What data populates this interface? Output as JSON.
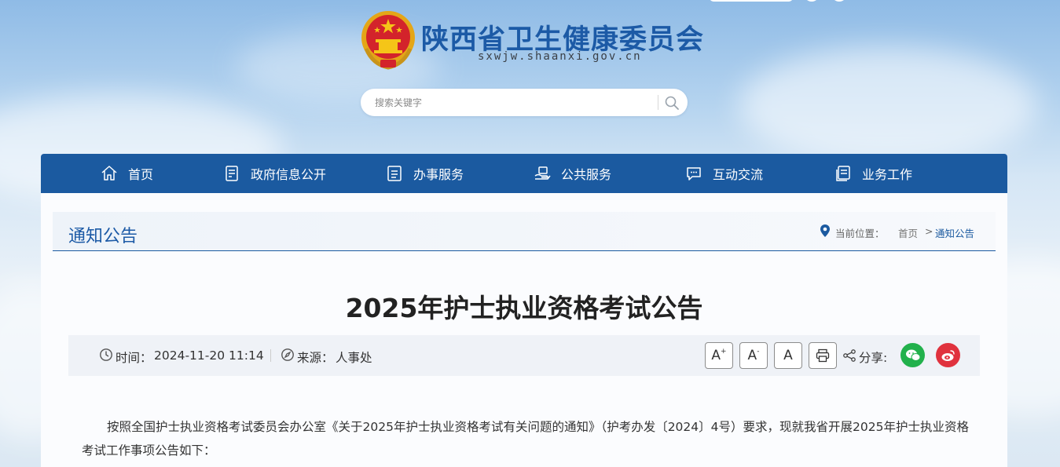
{
  "header": {
    "site_name": "陕西省卫生健康委员会",
    "site_domain": "sxwjw.shaanxi.gov.cn",
    "search_placeholder": "搜索关键字"
  },
  "nav": {
    "items": [
      {
        "label": "首页",
        "icon": "home-icon"
      },
      {
        "label": "政府信息公开",
        "icon": "document-icon"
      },
      {
        "label": "办事服务",
        "icon": "service-icon"
      },
      {
        "label": "公共服务",
        "icon": "public-service-icon"
      },
      {
        "label": "互动交流",
        "icon": "chat-icon"
      },
      {
        "label": "业务工作",
        "icon": "work-icon"
      }
    ]
  },
  "section": {
    "title": "通知公告",
    "breadcrumb_prefix": "当前位置：",
    "breadcrumb": [
      "首页",
      "通知公告"
    ],
    "breadcrumb_separator": ">"
  },
  "article": {
    "title": "2025年护士执业资格考试公告",
    "time_label": "时间：",
    "time_value": "2024-11-20 11:14",
    "source_label": "来源：",
    "source_value": "人事处",
    "share_label": "分享:",
    "font_buttons": [
      "A",
      "A",
      "A"
    ],
    "body": "按照全国护士执业资格考试委员会办公室《关于2025年护士执业资格考试有关问题的通知》（护考办发〔2024〕4号）要求，现就我省开展2025年护士执业资格考试工作事项公告如下："
  },
  "colors": {
    "brand_blue": "#1b5aa0",
    "wechat_green": "#22b14c",
    "weibo_red": "#e0323e"
  }
}
